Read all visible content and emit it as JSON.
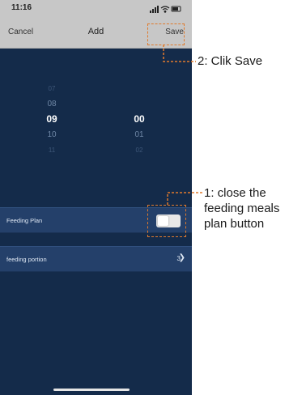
{
  "status_bar": {
    "time": "11:16"
  },
  "nav": {
    "cancel_label": "Cancel",
    "title": "Add",
    "save_label": "Save"
  },
  "time_picker": {
    "hours": [
      "07",
      "08",
      "09",
      "10",
      "11"
    ],
    "minutes": [
      "00",
      "01",
      "02"
    ],
    "selected_hour": "09",
    "selected_minute": "00"
  },
  "rows": {
    "feeding_plan_label": "Feeding Plan",
    "feeding_plan_enabled": false,
    "feeding_portion_label": "feeding portion",
    "feeding_portion_value": "3"
  },
  "annotations": {
    "save": "2: Clik Save",
    "toggle": "1: close the feeding meals plan button"
  },
  "colors": {
    "background": "#142b4a",
    "row": "#24406a",
    "header": "#c7c7c7",
    "highlight": "#e07a2c"
  }
}
